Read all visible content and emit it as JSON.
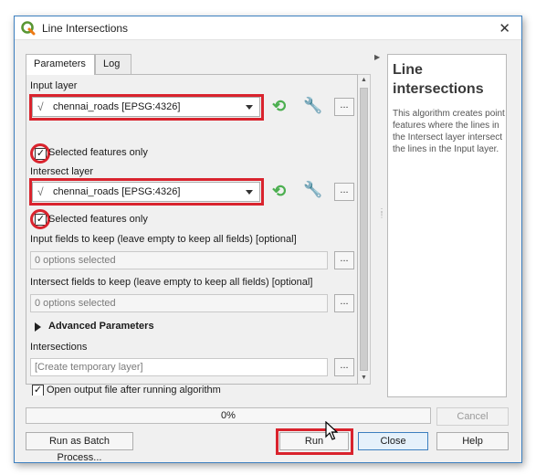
{
  "window": {
    "title": "Line Intersections"
  },
  "tabs": [
    {
      "label": "Parameters"
    },
    {
      "label": "Log"
    }
  ],
  "params": {
    "input_layer_label": "Input layer",
    "input_layer_value": "chennai_roads [EPSG:4326]",
    "input_selected_only": "Selected features only",
    "intersect_layer_label": "Intersect layer",
    "intersect_layer_value": "chennai_roads [EPSG:4326]",
    "intersect_selected_only": "Selected features only",
    "input_fields_label": "Input fields to keep (leave empty to keep all fields) [optional]",
    "input_fields_value": "0 options selected",
    "intersect_fields_label": "Intersect fields to keep (leave empty to keep all fields) [optional]",
    "intersect_fields_value": "0 options selected",
    "advanced_label": "Advanced Parameters",
    "intersections_label": "Intersections",
    "intersections_placeholder": "[Create temporary layer]",
    "open_output_label": "Open output file after running algorithm",
    "dots": "..."
  },
  "help": {
    "title": "Line intersections",
    "body": "This algorithm creates point features where the lines in the Intersect layer intersect the lines in the Input layer."
  },
  "progress": {
    "text": "0%",
    "value": 0
  },
  "buttons": {
    "cancel": "Cancel",
    "batch": "Run as Batch Process...",
    "run": "Run",
    "close": "Close",
    "help": "Help"
  },
  "colors": {
    "highlight": "#d9232d",
    "iterate": "#4caf50"
  }
}
